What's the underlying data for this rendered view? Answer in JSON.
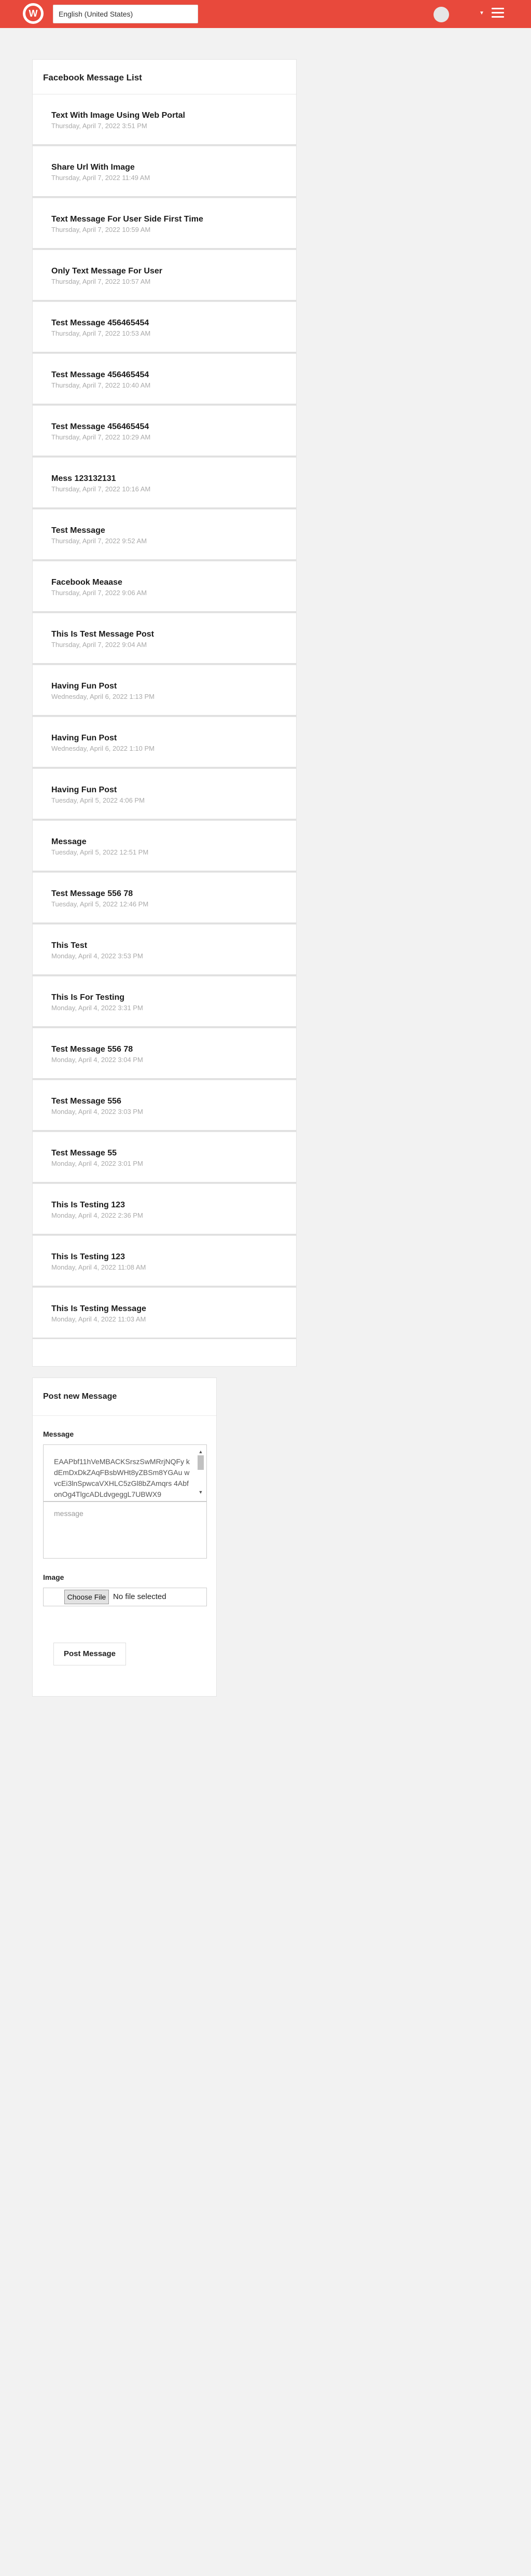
{
  "header": {
    "logo_letter": "W",
    "language": "English (United States)"
  },
  "list": {
    "title": "Facebook Message List",
    "items": [
      {
        "title": "Text With Image Using Web Portal",
        "date": "Thursday, April 7, 2022 3:51 PM"
      },
      {
        "title": "Share Url With Image",
        "date": "Thursday, April 7, 2022 11:49 AM"
      },
      {
        "title": "Text Message For User Side First Time",
        "date": "Thursday, April 7, 2022 10:59 AM"
      },
      {
        "title": "Only Text Message For User",
        "date": "Thursday, April 7, 2022 10:57 AM"
      },
      {
        "title": "Test Message 456465454",
        "date": "Thursday, April 7, 2022 10:53 AM"
      },
      {
        "title": "Test Message 456465454",
        "date": "Thursday, April 7, 2022 10:40 AM"
      },
      {
        "title": "Test Message 456465454",
        "date": "Thursday, April 7, 2022 10:29 AM"
      },
      {
        "title": "Mess 123132131",
        "date": "Thursday, April 7, 2022 10:16 AM"
      },
      {
        "title": "Test Message",
        "date": "Thursday, April 7, 2022 9:52 AM"
      },
      {
        "title": "Facebook Meaase",
        "date": "Thursday, April 7, 2022 9:06 AM"
      },
      {
        "title": "This Is Test Message Post",
        "date": "Thursday, April 7, 2022 9:04 AM"
      },
      {
        "title": "Having Fun Post",
        "date": "Wednesday, April 6, 2022 1:13 PM"
      },
      {
        "title": "Having Fun Post",
        "date": "Wednesday, April 6, 2022 1:10 PM"
      },
      {
        "title": "Having Fun Post",
        "date": "Tuesday, April 5, 2022 4:06 PM"
      },
      {
        "title": "Message",
        "date": "Tuesday, April 5, 2022 12:51 PM"
      },
      {
        "title": "Test Message 556 78",
        "date": "Tuesday, April 5, 2022 12:46 PM"
      },
      {
        "title": "This Test",
        "date": "Monday, April 4, 2022 3:53 PM"
      },
      {
        "title": "This Is For Testing",
        "date": "Monday, April 4, 2022 3:31 PM"
      },
      {
        "title": "Test Message 556 78",
        "date": "Monday, April 4, 2022 3:04 PM"
      },
      {
        "title": "Test Message 556",
        "date": "Monday, April 4, 2022 3:03 PM"
      },
      {
        "title": "Test Message 55",
        "date": "Monday, April 4, 2022 3:01 PM"
      },
      {
        "title": "This Is Testing 123",
        "date": "Monday, April 4, 2022 2:36 PM"
      },
      {
        "title": "This Is Testing 123",
        "date": "Monday, April 4, 2022 11:08 AM"
      },
      {
        "title": "This Is Testing Message",
        "date": "Monday, April 4, 2022 11:03 AM"
      }
    ]
  },
  "post_form": {
    "title": "Post new Message",
    "message_label": "Message",
    "token_text": "EAAPbf11hVeMBACKSrszSwMRrjNQFy kdEmDxDkZAqFBsbWHt8yZBSm8YGAu wvcEi3lnSpwcaVXHLC5zGl8bZAmqrs 4AbfonOg4TlgcADLdvgeggL7UBWX9",
    "message_placeholder": "message",
    "image_label": "Image",
    "choose_file_label": "Choose File",
    "file_status": "No file selected",
    "submit_label": "Post Message"
  }
}
